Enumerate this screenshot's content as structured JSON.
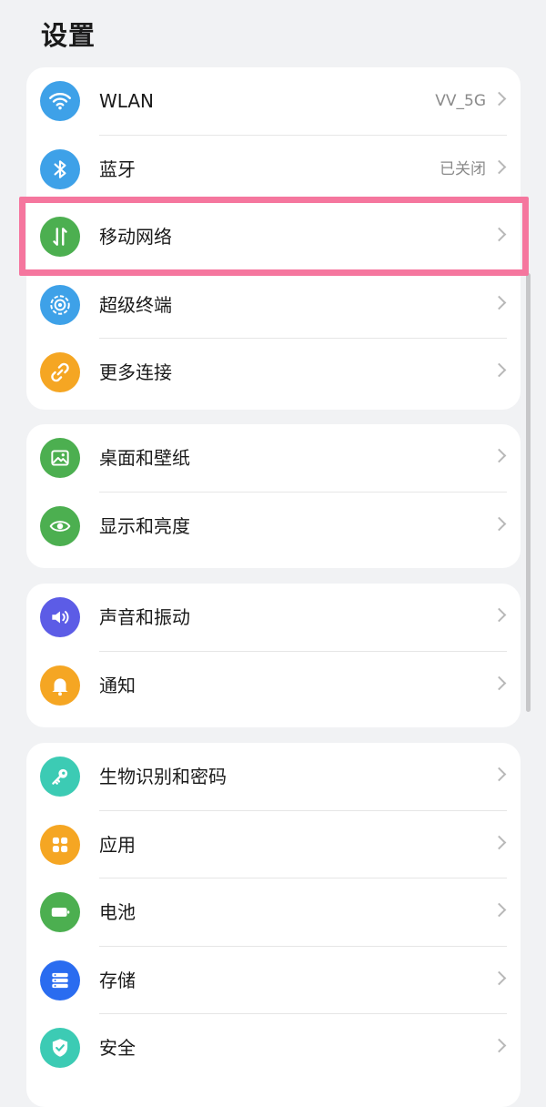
{
  "page": {
    "title": "设置"
  },
  "groups": [
    {
      "items": [
        {
          "label": "WLAN",
          "value": "VV_5G",
          "icon": "wifi-icon",
          "color": "#3ea1e8"
        },
        {
          "label": "蓝牙",
          "value": "已关闭",
          "icon": "bluetooth-icon",
          "color": "#3ea1e8"
        },
        {
          "label": "移动网络",
          "value": "",
          "icon": "mobile-data-icon",
          "color": "#4caf50"
        },
        {
          "label": "超级终端",
          "value": "",
          "icon": "super-device-icon",
          "color": "#3ea1e8"
        },
        {
          "label": "更多连接",
          "value": "",
          "icon": "link-icon",
          "color": "#f5a623"
        }
      ]
    },
    {
      "items": [
        {
          "label": "桌面和壁纸",
          "value": "",
          "icon": "wallpaper-icon",
          "color": "#4caf50"
        },
        {
          "label": "显示和亮度",
          "value": "",
          "icon": "eye-icon",
          "color": "#4caf50"
        }
      ]
    },
    {
      "items": [
        {
          "label": "声音和振动",
          "value": "",
          "icon": "speaker-icon",
          "color": "#5c5ce6"
        },
        {
          "label": "通知",
          "value": "",
          "icon": "bell-icon",
          "color": "#f5a623"
        }
      ]
    },
    {
      "items": [
        {
          "label": "生物识别和密码",
          "value": "",
          "icon": "key-icon",
          "color": "#3ccbb4"
        },
        {
          "label": "应用",
          "value": "",
          "icon": "apps-icon",
          "color": "#f5a623"
        },
        {
          "label": "电池",
          "value": "",
          "icon": "battery-icon",
          "color": "#4caf50"
        },
        {
          "label": "存储",
          "value": "",
          "icon": "storage-icon",
          "color": "#2a6cf0"
        },
        {
          "label": "安全",
          "value": "",
          "icon": "shield-icon",
          "color": "#3ccbb4"
        }
      ]
    }
  ]
}
